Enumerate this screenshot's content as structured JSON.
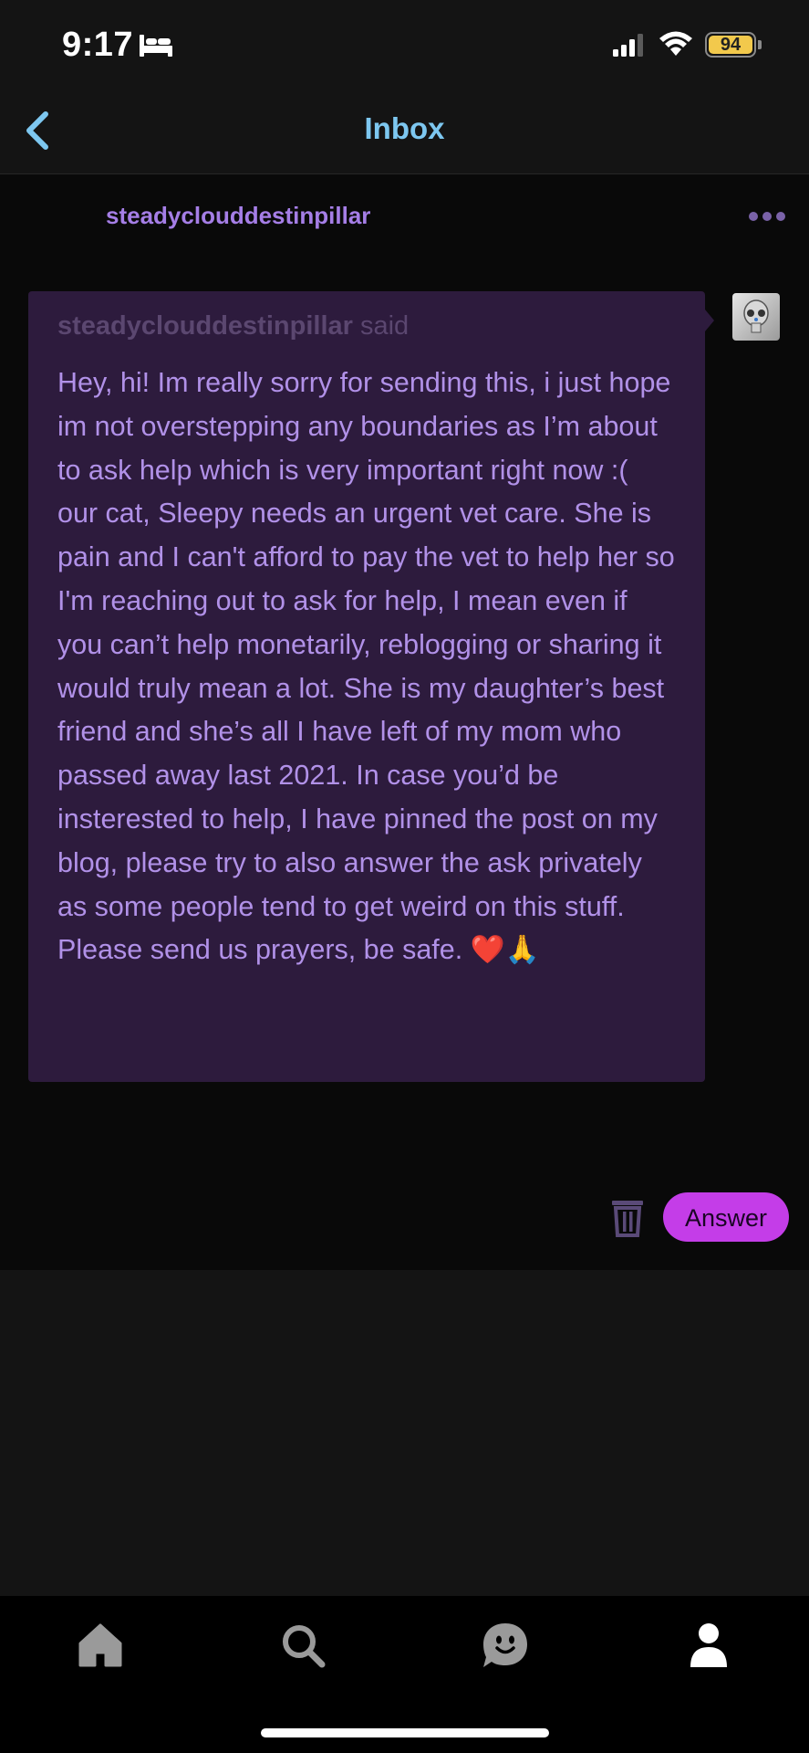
{
  "status_bar": {
    "time": "9:17",
    "battery": "94",
    "battery_level": 0.94,
    "icons": [
      "bed-icon",
      "signal-icon",
      "wifi-icon",
      "battery-icon"
    ]
  },
  "header": {
    "title": "Inbox",
    "back_icon": "chevron-left-icon"
  },
  "conversation": {
    "sender": "steadyclouddestinpillar",
    "more_icon": "ellipsis-icon",
    "ask": {
      "username": "steadyclouddestinpillar",
      "said": "said",
      "message": "Hey, hi! Im really sorry for sending this, i just hope im not overstepping any boundaries as I’m about to ask help which is very important right now :( our cat, Sleepy needs an urgent vet care. She is pain and I can't afford to pay the vet to help her so I'm reaching out to ask for help, I mean even if you can’t help monetarily, reblogging or sharing it would truly mean a lot. She is my daughter’s best friend and she’s all I have left of my mom who passed away last 2021. In case you’d be insterested to help, I have pinned the post on my blog, please try to also answer the ask privately as some people tend to get weird on this stuff. Please send us prayers, be safe. ❤️🙏"
    },
    "actions": {
      "delete_icon": "trash-icon",
      "answer_label": "Answer"
    }
  },
  "tabbar": {
    "items": [
      "home-icon",
      "search-icon",
      "activity-face-icon",
      "account-icon"
    ]
  },
  "colors": {
    "accent_blue": "#7dc7f0",
    "accent_purple": "#a57ee6",
    "bubble_bg": "#2d1b3d",
    "answer_button": "#c43de8"
  }
}
